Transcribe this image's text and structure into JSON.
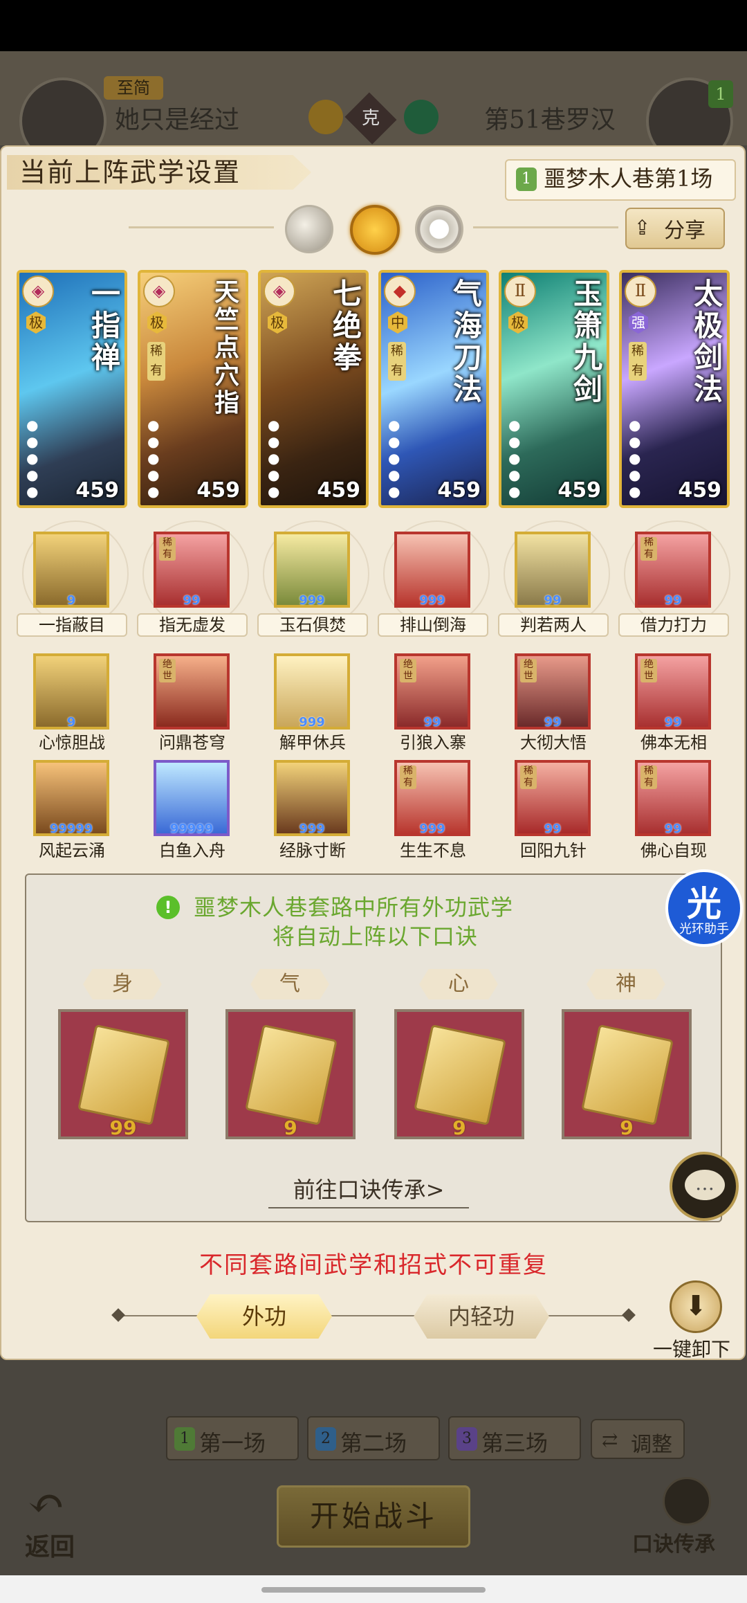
{
  "header": {
    "player_badge": "至简",
    "player_name": "她只是经过",
    "vs_label": "克",
    "enemy_name": "第51巷罗汉",
    "enemy_level": "1"
  },
  "panel": {
    "title": "当前上阵武学设置",
    "stage_number": "1",
    "stage_label": "噩梦木人巷第1场",
    "share_label": "分享",
    "element_selectors": [
      "moon-icon",
      "sun-icon",
      "ring-icon"
    ]
  },
  "cards": [
    {
      "name": "一指禅",
      "tier": "极",
      "rare": "",
      "level": "459"
    },
    {
      "name": "天竺点穴指",
      "tier": "极",
      "rare": "稀有",
      "level": "459"
    },
    {
      "name": "七绝拳",
      "tier": "极",
      "rare": "",
      "level": "459"
    },
    {
      "name": "气海刀法",
      "tier": "中",
      "rare": "稀有",
      "level": "459"
    },
    {
      "name": "玉箫九剑",
      "tier": "极",
      "rare": "",
      "level": "459"
    },
    {
      "name": "太极剑法",
      "tier": "强",
      "rare": "稀有",
      "level": "459"
    }
  ],
  "skills": {
    "row1": [
      {
        "label": "一指蔽目",
        "count": "9"
      },
      {
        "label": "指无虚发",
        "count": "99"
      },
      {
        "label": "玉石俱焚",
        "count": "999"
      },
      {
        "label": "排山倒海",
        "count": "999"
      },
      {
        "label": "判若两人",
        "count": "99"
      },
      {
        "label": "借力打力",
        "count": "99"
      }
    ],
    "row2": [
      {
        "label": "心惊胆战",
        "count": "9"
      },
      {
        "label": "问鼎苍穹",
        "count": ""
      },
      {
        "label": "解甲休兵",
        "count": "999"
      },
      {
        "label": "引狼入寨",
        "count": "99"
      },
      {
        "label": "大彻大悟",
        "count": "99"
      },
      {
        "label": "佛本无相",
        "count": "99"
      }
    ],
    "row3": [
      {
        "label": "风起云涌",
        "count": "99999"
      },
      {
        "label": "白鱼入舟",
        "count": "99999"
      },
      {
        "label": "经脉寸断",
        "count": "999"
      },
      {
        "label": "生生不息",
        "count": "999"
      },
      {
        "label": "回阳九针",
        "count": "99"
      },
      {
        "label": "佛心自现",
        "count": "99"
      }
    ],
    "tags": {
      "rare": "稀有",
      "unique": "绝世"
    }
  },
  "mantra": {
    "line1": "噩梦木人巷套路中所有外功武学",
    "line2": "将自动上阵以下口诀",
    "slots": [
      {
        "tag": "身",
        "count": "99"
      },
      {
        "tag": "气",
        "count": "9"
      },
      {
        "tag": "心",
        "count": "9"
      },
      {
        "tag": "神",
        "count": "9"
      }
    ],
    "link": "前往口诀传承>"
  },
  "helper": {
    "char": "光",
    "label": "光环助手"
  },
  "warning": "不同套路间武学和招式不可重复",
  "tabs": {
    "active": "外功",
    "inactive": "内轻功"
  },
  "unload_label": "一键卸下",
  "bottom": {
    "matches": [
      {
        "num": "1",
        "label": "第一场",
        "color": "#6ca84a"
      },
      {
        "num": "2",
        "label": "第二场",
        "color": "#3a8acb"
      },
      {
        "num": "3",
        "label": "第三场",
        "color": "#7e5ab8"
      }
    ],
    "adjust_label": "调整",
    "start_label": "开始战斗",
    "back_label": "返回",
    "chuan_label": "口诀传承"
  },
  "colors": {
    "panel_bg": "#f2ead9",
    "warning_red": "#d9272b",
    "info_green": "#6aa72f",
    "card_gold": "#e0b53a"
  }
}
